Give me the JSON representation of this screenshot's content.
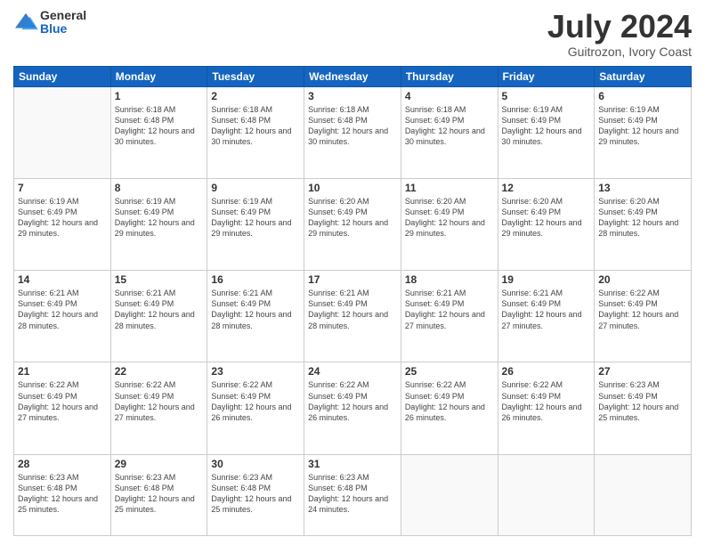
{
  "header": {
    "logo_general": "General",
    "logo_blue": "Blue",
    "month_title": "July 2024",
    "subtitle": "Guitrozon, Ivory Coast"
  },
  "days_of_week": [
    "Sunday",
    "Monday",
    "Tuesday",
    "Wednesday",
    "Thursday",
    "Friday",
    "Saturday"
  ],
  "weeks": [
    [
      {
        "day": "",
        "sunrise": "",
        "sunset": "",
        "daylight": "",
        "empty": true
      },
      {
        "day": "1",
        "sunrise": "Sunrise: 6:18 AM",
        "sunset": "Sunset: 6:48 PM",
        "daylight": "Daylight: 12 hours and 30 minutes."
      },
      {
        "day": "2",
        "sunrise": "Sunrise: 6:18 AM",
        "sunset": "Sunset: 6:48 PM",
        "daylight": "Daylight: 12 hours and 30 minutes."
      },
      {
        "day": "3",
        "sunrise": "Sunrise: 6:18 AM",
        "sunset": "Sunset: 6:48 PM",
        "daylight": "Daylight: 12 hours and 30 minutes."
      },
      {
        "day": "4",
        "sunrise": "Sunrise: 6:18 AM",
        "sunset": "Sunset: 6:49 PM",
        "daylight": "Daylight: 12 hours and 30 minutes."
      },
      {
        "day": "5",
        "sunrise": "Sunrise: 6:19 AM",
        "sunset": "Sunset: 6:49 PM",
        "daylight": "Daylight: 12 hours and 30 minutes."
      },
      {
        "day": "6",
        "sunrise": "Sunrise: 6:19 AM",
        "sunset": "Sunset: 6:49 PM",
        "daylight": "Daylight: 12 hours and 29 minutes."
      }
    ],
    [
      {
        "day": "7",
        "sunrise": "Sunrise: 6:19 AM",
        "sunset": "Sunset: 6:49 PM",
        "daylight": "Daylight: 12 hours and 29 minutes."
      },
      {
        "day": "8",
        "sunrise": "Sunrise: 6:19 AM",
        "sunset": "Sunset: 6:49 PM",
        "daylight": "Daylight: 12 hours and 29 minutes."
      },
      {
        "day": "9",
        "sunrise": "Sunrise: 6:19 AM",
        "sunset": "Sunset: 6:49 PM",
        "daylight": "Daylight: 12 hours and 29 minutes."
      },
      {
        "day": "10",
        "sunrise": "Sunrise: 6:20 AM",
        "sunset": "Sunset: 6:49 PM",
        "daylight": "Daylight: 12 hours and 29 minutes."
      },
      {
        "day": "11",
        "sunrise": "Sunrise: 6:20 AM",
        "sunset": "Sunset: 6:49 PM",
        "daylight": "Daylight: 12 hours and 29 minutes."
      },
      {
        "day": "12",
        "sunrise": "Sunrise: 6:20 AM",
        "sunset": "Sunset: 6:49 PM",
        "daylight": "Daylight: 12 hours and 29 minutes."
      },
      {
        "day": "13",
        "sunrise": "Sunrise: 6:20 AM",
        "sunset": "Sunset: 6:49 PM",
        "daylight": "Daylight: 12 hours and 28 minutes."
      }
    ],
    [
      {
        "day": "14",
        "sunrise": "Sunrise: 6:21 AM",
        "sunset": "Sunset: 6:49 PM",
        "daylight": "Daylight: 12 hours and 28 minutes."
      },
      {
        "day": "15",
        "sunrise": "Sunrise: 6:21 AM",
        "sunset": "Sunset: 6:49 PM",
        "daylight": "Daylight: 12 hours and 28 minutes."
      },
      {
        "day": "16",
        "sunrise": "Sunrise: 6:21 AM",
        "sunset": "Sunset: 6:49 PM",
        "daylight": "Daylight: 12 hours and 28 minutes."
      },
      {
        "day": "17",
        "sunrise": "Sunrise: 6:21 AM",
        "sunset": "Sunset: 6:49 PM",
        "daylight": "Daylight: 12 hours and 28 minutes."
      },
      {
        "day": "18",
        "sunrise": "Sunrise: 6:21 AM",
        "sunset": "Sunset: 6:49 PM",
        "daylight": "Daylight: 12 hours and 27 minutes."
      },
      {
        "day": "19",
        "sunrise": "Sunrise: 6:21 AM",
        "sunset": "Sunset: 6:49 PM",
        "daylight": "Daylight: 12 hours and 27 minutes."
      },
      {
        "day": "20",
        "sunrise": "Sunrise: 6:22 AM",
        "sunset": "Sunset: 6:49 PM",
        "daylight": "Daylight: 12 hours and 27 minutes."
      }
    ],
    [
      {
        "day": "21",
        "sunrise": "Sunrise: 6:22 AM",
        "sunset": "Sunset: 6:49 PM",
        "daylight": "Daylight: 12 hours and 27 minutes."
      },
      {
        "day": "22",
        "sunrise": "Sunrise: 6:22 AM",
        "sunset": "Sunset: 6:49 PM",
        "daylight": "Daylight: 12 hours and 27 minutes."
      },
      {
        "day": "23",
        "sunrise": "Sunrise: 6:22 AM",
        "sunset": "Sunset: 6:49 PM",
        "daylight": "Daylight: 12 hours and 26 minutes."
      },
      {
        "day": "24",
        "sunrise": "Sunrise: 6:22 AM",
        "sunset": "Sunset: 6:49 PM",
        "daylight": "Daylight: 12 hours and 26 minutes."
      },
      {
        "day": "25",
        "sunrise": "Sunrise: 6:22 AM",
        "sunset": "Sunset: 6:49 PM",
        "daylight": "Daylight: 12 hours and 26 minutes."
      },
      {
        "day": "26",
        "sunrise": "Sunrise: 6:22 AM",
        "sunset": "Sunset: 6:49 PM",
        "daylight": "Daylight: 12 hours and 26 minutes."
      },
      {
        "day": "27",
        "sunrise": "Sunrise: 6:23 AM",
        "sunset": "Sunset: 6:49 PM",
        "daylight": "Daylight: 12 hours and 25 minutes."
      }
    ],
    [
      {
        "day": "28",
        "sunrise": "Sunrise: 6:23 AM",
        "sunset": "Sunset: 6:48 PM",
        "daylight": "Daylight: 12 hours and 25 minutes."
      },
      {
        "day": "29",
        "sunrise": "Sunrise: 6:23 AM",
        "sunset": "Sunset: 6:48 PM",
        "daylight": "Daylight: 12 hours and 25 minutes."
      },
      {
        "day": "30",
        "sunrise": "Sunrise: 6:23 AM",
        "sunset": "Sunset: 6:48 PM",
        "daylight": "Daylight: 12 hours and 25 minutes."
      },
      {
        "day": "31",
        "sunrise": "Sunrise: 6:23 AM",
        "sunset": "Sunset: 6:48 PM",
        "daylight": "Daylight: 12 hours and 24 minutes."
      },
      {
        "day": "",
        "sunrise": "",
        "sunset": "",
        "daylight": "",
        "empty": true
      },
      {
        "day": "",
        "sunrise": "",
        "sunset": "",
        "daylight": "",
        "empty": true
      },
      {
        "day": "",
        "sunrise": "",
        "sunset": "",
        "daylight": "",
        "empty": true
      }
    ]
  ]
}
